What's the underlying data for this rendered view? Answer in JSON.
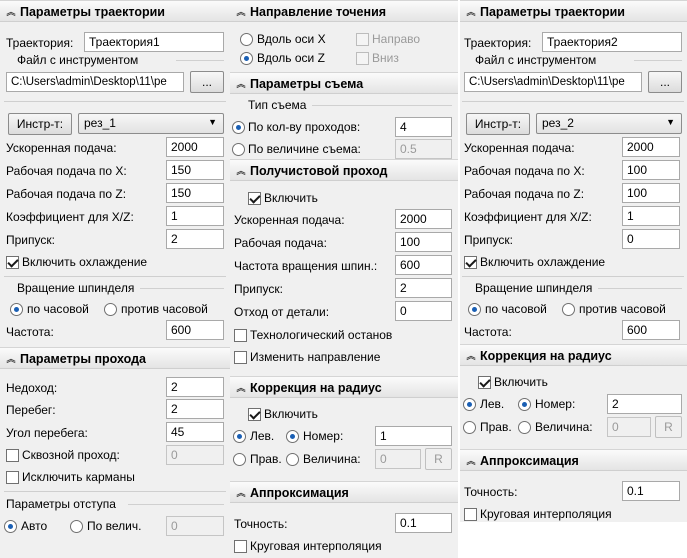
{
  "left": {
    "traj_header": "Параметры траектории",
    "traj_label": "Траектория:",
    "traj_value": "Траектория1",
    "file_group": "Файл с инструментом",
    "file_path": "C:\\Users\\admin\\Desktop\\11\\ре",
    "browse": "...",
    "tool_btn": "Инстр-т:",
    "tool_select": "рез_1",
    "f_rapid": "Ускоренная подача:",
    "v_rapid": "2000",
    "f_feed_x": "Рабочая подача по X:",
    "v_feed_x": "150",
    "f_feed_z": "Рабочая подача по Z:",
    "v_feed_z": "150",
    "f_coef": "Коэффициент для X/Z:",
    "v_coef": "1",
    "f_allow": "Припуск:",
    "v_allow": "2",
    "cooling": "Включить охлаждение",
    "spin_group": "Вращение шпинделя",
    "cw": "по часовой",
    "ccw": "против часовой",
    "freq_label": "Частота:",
    "freq_value": "600",
    "pass_header": "Параметры прохода",
    "under_label": "Недоход:",
    "under_value": "2",
    "over_label": "Перебег:",
    "over_value": "2",
    "angle_label": "Угол перебега:",
    "angle_value": "45",
    "through": "Сквозной проход:",
    "through_value": "0",
    "pockets": "Исключить карманы",
    "retract_group": "Параметры отступа",
    "auto": "Авто",
    "by_value": "По велич.",
    "by_value_v": "0"
  },
  "mid": {
    "dir_header": "Направление точения",
    "along_x": "Вдоль оси X",
    "along_z": "Вдоль оси Z",
    "right": "Направо",
    "down": "Вниз",
    "removal_header": "Параметры съема",
    "removal_group": "Тип съема",
    "by_passes": "По кол-ву проходов:",
    "by_passes_v": "4",
    "by_size": "По величине съема:",
    "by_size_v": "0.5",
    "semi_header": "Получистовой проход",
    "enable": "Включить",
    "rapid": "Ускоренная подача:",
    "rapid_v": "2000",
    "feed": "Рабочая подача:",
    "feed_v": "100",
    "speed": "Частота вращения шпин.:",
    "speed_v": "600",
    "allow": "Припуск:",
    "allow_v": "2",
    "offset": "Отход от детали:",
    "offset_v": "0",
    "tech_stop": "Технологический останов",
    "change_dir": "Изменить направление",
    "radius_header": "Коррекция на радиус",
    "r_enable": "Включить",
    "left_r": "Лев.",
    "num": "Номер:",
    "num_v": "1",
    "right_r": "Прав.",
    "size": "Величина:",
    "size_v": "0",
    "r_btn": "R",
    "approx_header": "Аппроксимация",
    "precision": "Точность:",
    "precision_v": "0.1",
    "circular": "Круговая интерполяция"
  },
  "right": {
    "traj_header": "Параметры траектории",
    "traj_label": "Траектория:",
    "traj_value": "Траектория2",
    "file_group": "Файл с инструментом",
    "file_path": "C:\\Users\\admin\\Desktop\\11\\ре",
    "browse": "...",
    "tool_btn": "Инстр-т:",
    "tool_select": "рез_2",
    "f_rapid": "Ускоренная подача:",
    "v_rapid": "2000",
    "f_feed_x": "Рабочая подача по X:",
    "v_feed_x": "100",
    "f_feed_z": "Рабочая подача по Z:",
    "v_feed_z": "100",
    "f_coef": "Коэффициент для X/Z:",
    "v_coef": "1",
    "f_allow": "Припуск:",
    "v_allow": "0",
    "cooling": "Включить охлаждение",
    "spin_group": "Вращение шпинделя",
    "cw": "по часовой",
    "ccw": "против часовой",
    "freq_label": "Частота:",
    "freq_value": "600",
    "radius_header": "Коррекция на радиус",
    "r_enable": "Включить",
    "left_r": "Лев.",
    "num": "Номер:",
    "num_v": "2",
    "right_r": "Прав.",
    "size": "Величина:",
    "size_v": "0",
    "r_btn": "R",
    "approx_header": "Аппроксимация",
    "precision": "Точность:",
    "precision_v": "0.1",
    "circular": "Круговая интерполяция"
  }
}
